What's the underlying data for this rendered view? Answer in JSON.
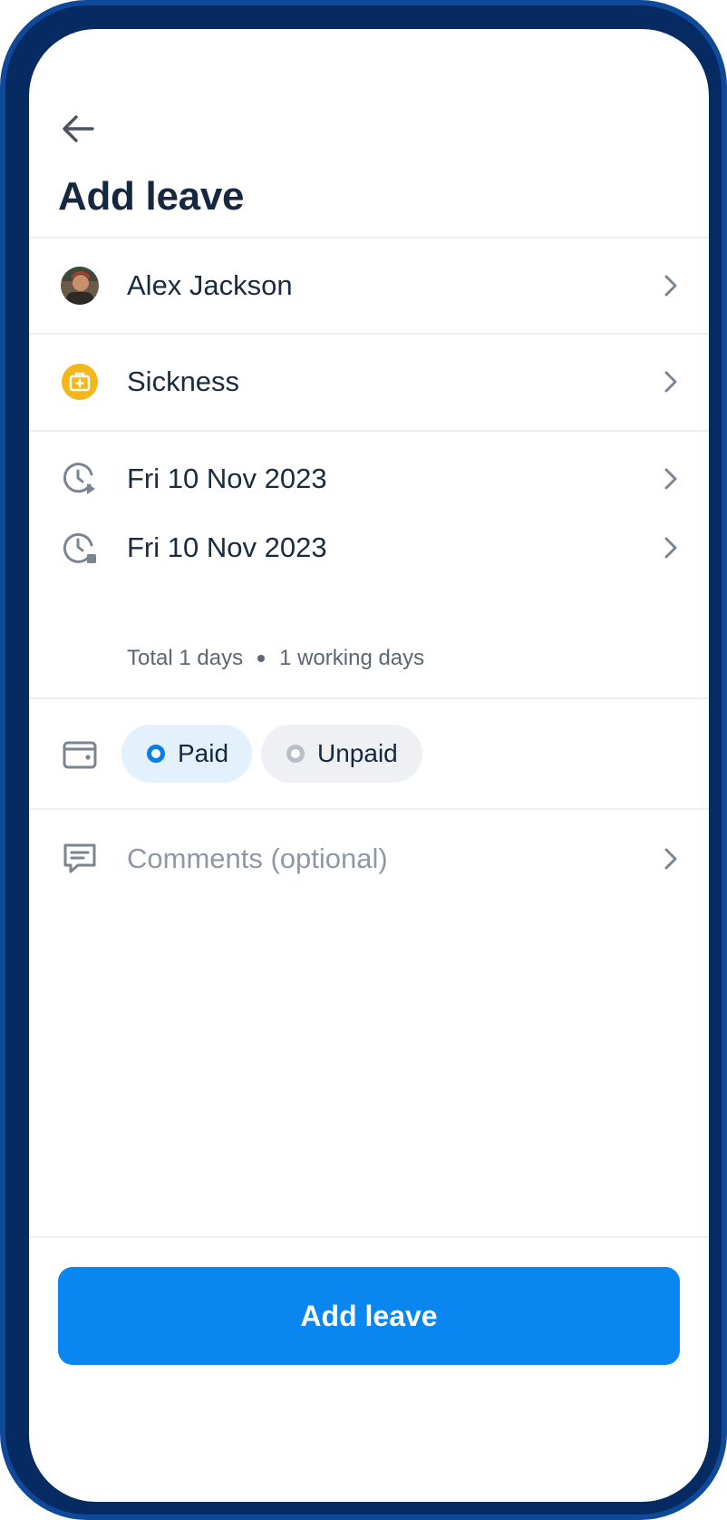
{
  "header": {
    "back_icon": "arrow-left-icon",
    "title": "Add leave"
  },
  "employee": {
    "name": "Alex Jackson",
    "avatar_icon": "avatar"
  },
  "leave_type": {
    "label": "Sickness",
    "icon": "medical-kit-icon",
    "icon_color": "#f3b71c"
  },
  "dates": {
    "start": "Fri 10 Nov 2023",
    "start_icon": "clock-play-icon",
    "end": "Fri 10 Nov 2023",
    "end_icon": "clock-stop-icon",
    "total": "Total 1 days",
    "working": "1 working days"
  },
  "payment": {
    "icon": "wallet-icon",
    "options": [
      {
        "label": "Paid",
        "selected": true
      },
      {
        "label": "Unpaid",
        "selected": false
      }
    ]
  },
  "comments": {
    "placeholder": "Comments (optional)",
    "icon": "comment-icon"
  },
  "footer": {
    "button_label": "Add leave"
  },
  "colors": {
    "accent": "#0a86f0",
    "frame": "#062b63",
    "text_primary": "#162840",
    "text_muted": "#8f98a3"
  }
}
